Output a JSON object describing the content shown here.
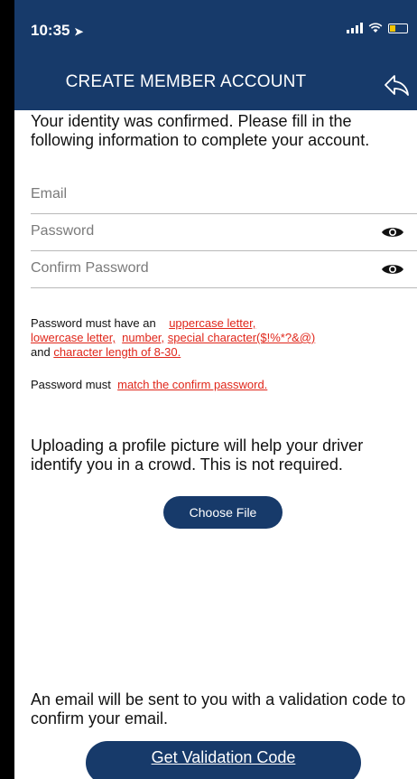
{
  "status_bar": {
    "time": "10:35"
  },
  "header": {
    "title": "CREATE MEMBER ACCOUNT"
  },
  "intro_text": "Your identity was confirmed. Please fill in the following information to complete your account.",
  "fields": {
    "email_placeholder": "Email",
    "password_placeholder": "Password",
    "confirm_password_placeholder": "Confirm Password"
  },
  "password_rules": {
    "prefix": "Password must have an",
    "uppercase": "uppercase letter,",
    "lowercase": "lowercase letter,",
    "number": "number,",
    "special": "special character($!%*?&@)",
    "and": "and",
    "length": "character length of 8-30."
  },
  "match_rule": {
    "prefix": "Password must",
    "requirement": "match the confirm password."
  },
  "upload": {
    "note": "Uploading a profile picture will help your driver identify you in a crowd. This is not required.",
    "button_label": "Choose File"
  },
  "email_note": "An email will be sent to you with a validation code to confirm your email.",
  "validate_button_label": "Get Validation Code",
  "colors": {
    "header_bg": "#173a6a",
    "requirement_red": "#e0261a"
  }
}
